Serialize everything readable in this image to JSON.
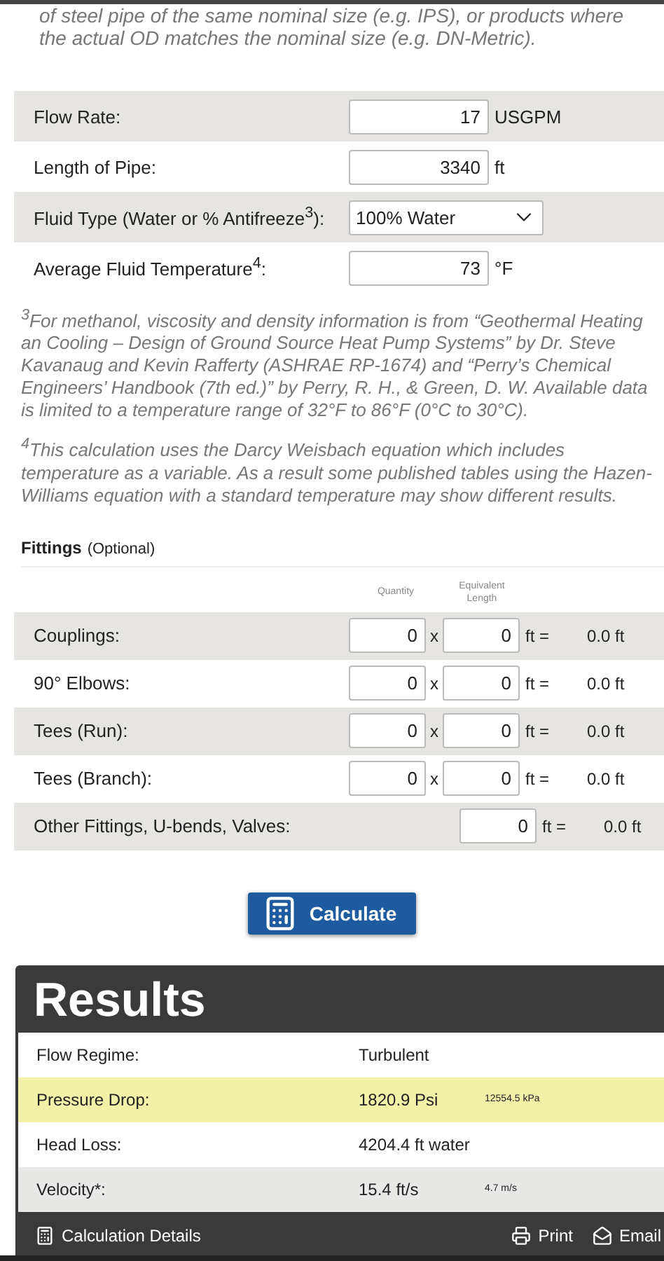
{
  "intro": "of steel pipe of the same nominal size (e.g. IPS), or products where the actual OD matches the nominal size (e.g. DN-Metric).",
  "inputs": [
    {
      "kind": "number",
      "label": "Flow Rate:",
      "value": "17",
      "unit": "USGPM"
    },
    {
      "kind": "number",
      "label": "Length of Pipe:",
      "value": "3340",
      "unit": "ft"
    },
    {
      "kind": "select",
      "label": "Fluid Type (Water or % Antifreeze$^{3}$):",
      "value": "100% Water"
    },
    {
      "kind": "number",
      "label": "Average Fluid Temperature$^{4}$:",
      "value": "73",
      "unit": "°F"
    }
  ],
  "footnotes": [
    "$^{3}$For methanol, viscosity and density information is from “Geothermal Heating an Cooling – Design of Ground Source Heat Pump Systems” by Dr. Steve Kavanaug and Kevin Rafferty (ASHRAE RP-1674) and “Perry’s Chemical Engineers’ Handbook (7th ed.)” by Perry, R. H., & Green, D. W. Available data is limited to a temperature range of 32°F to 86°F (0°C to 30°C).",
    "$^{4}$This calculation uses the Darcy Weisbach equation which includes temperature as a variable. As a result some published tables using the Hazen-Williams equation with a standard temperature may show different results."
  ],
  "fittings": {
    "title": "Fittings",
    "note": "(Optional)",
    "headers": [
      "Quantity",
      "Equivalent Length"
    ],
    "rows": [
      {
        "kind": "pair",
        "label": "Couplings:",
        "quantity": "0",
        "times": "x",
        "length": "0",
        "equals": "ft =",
        "total": "0.0 ft"
      },
      {
        "kind": "pair",
        "label": "90° Elbows:",
        "quantity": "0",
        "times": "x",
        "length": "0",
        "equals": "ft =",
        "total": "0.0 ft"
      },
      {
        "kind": "pair",
        "label": "Tees (Run):",
        "quantity": "0",
        "times": "x",
        "length": "0",
        "equals": "ft =",
        "total": "0.0 ft"
      },
      {
        "kind": "pair",
        "label": "Tees (Branch):",
        "quantity": "0",
        "times": "x",
        "length": "0",
        "equals": "ft =",
        "total": "0.0 ft"
      },
      {
        "kind": "single",
        "label": "Other Fittings, U-bends, Valves:",
        "length": "0",
        "equals": "ft =",
        "total": "0.0 ft"
      }
    ]
  },
  "calculate_button": "Calculate",
  "results": {
    "title": "Results",
    "rows": [
      {
        "label": "Flow Regime:",
        "value": "Turbulent",
        "highlighted": false
      },
      {
        "label": "Pressure Drop:",
        "value": "1820.9 Psi",
        "secondary": "12554.5 kPa",
        "highlighted": true
      },
      {
        "label": "Head Loss:",
        "value": "4204.4 ft water",
        "highlighted": false
      },
      {
        "label": "Velocity*:",
        "value": "15.4 ft/s",
        "secondary": "4.7 m/s",
        "highlighted": false
      }
    ],
    "footer": {
      "details": "Calculation Details",
      "print": "Print",
      "email": "Email"
    }
  }
}
